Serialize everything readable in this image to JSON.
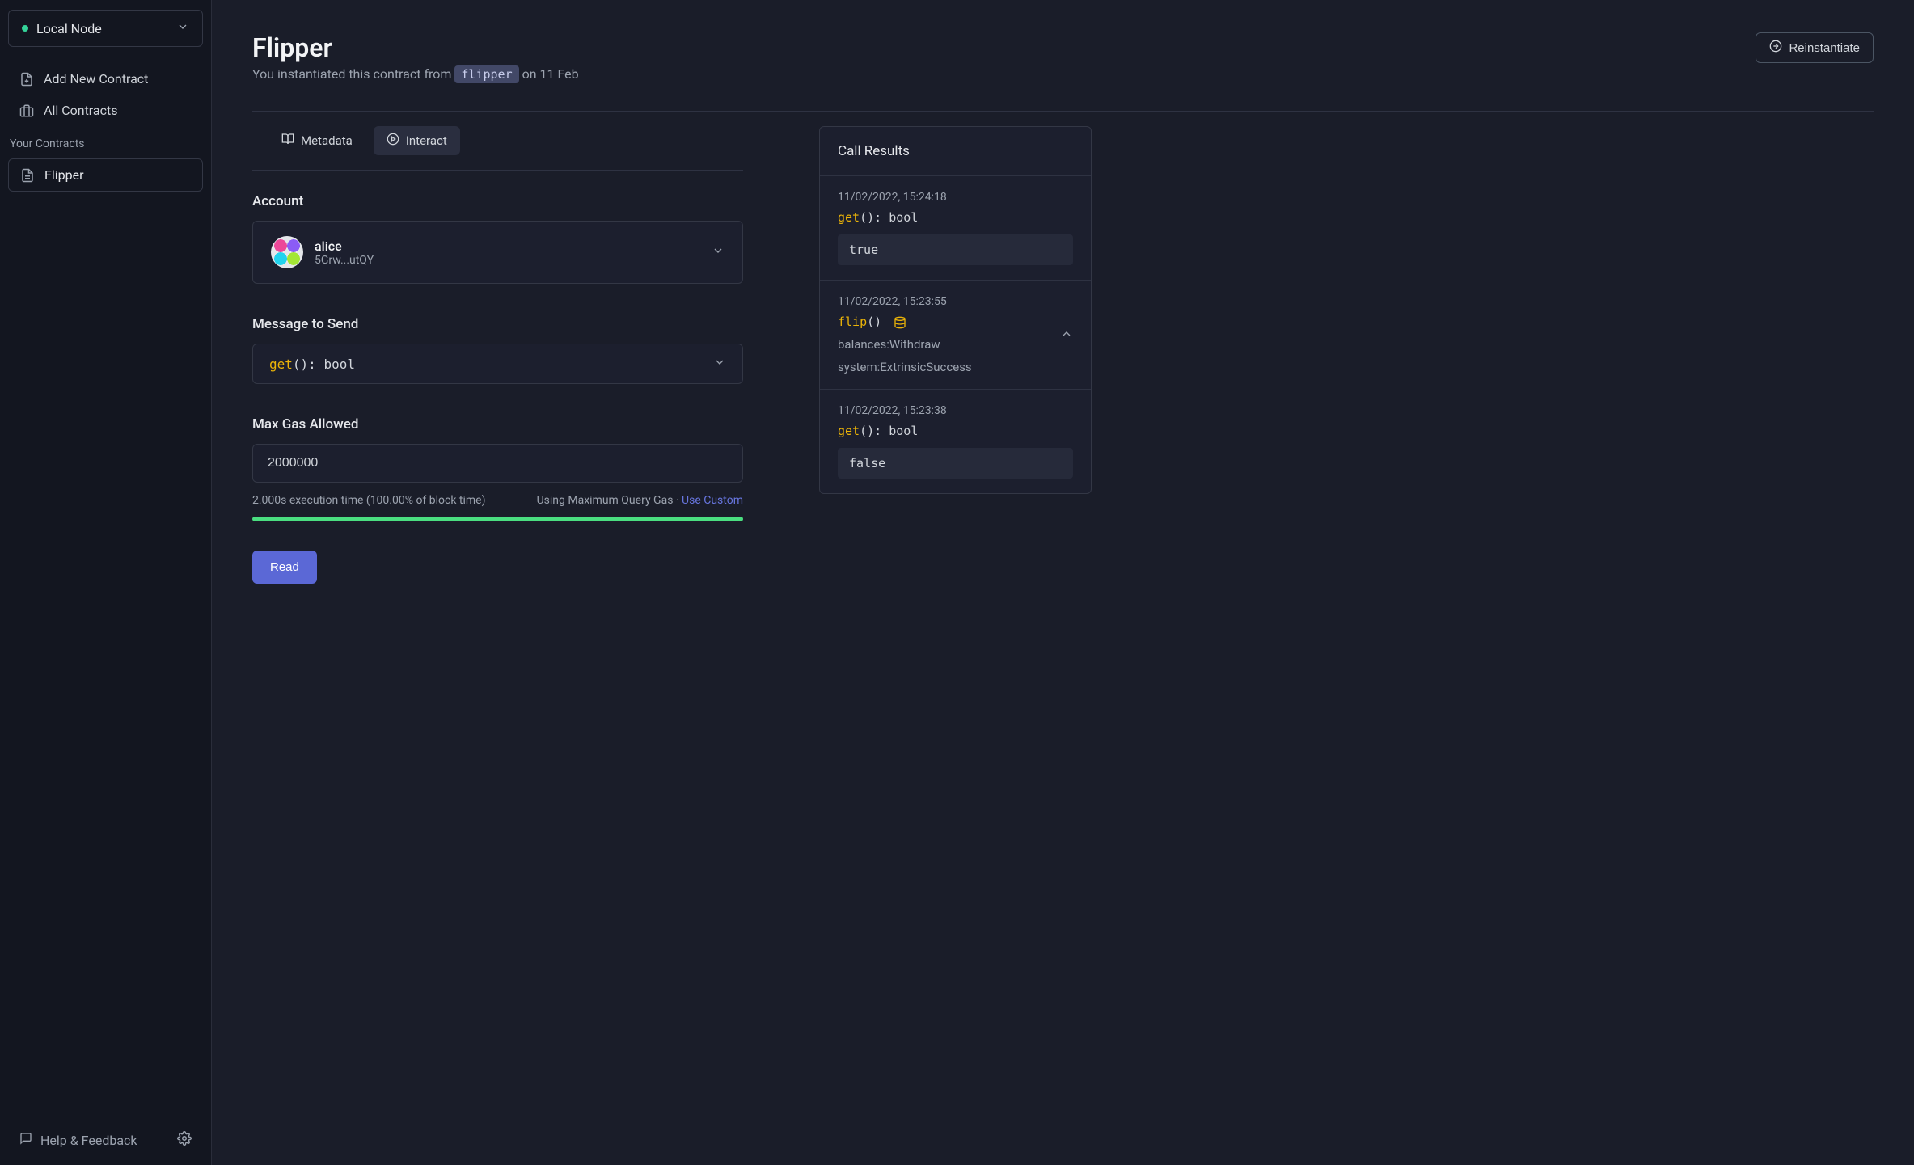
{
  "sidebar": {
    "node_label": "Local Node",
    "add_contract": "Add New Contract",
    "all_contracts": "All Contracts",
    "section_label": "Your Contracts",
    "contracts": [
      {
        "name": "Flipper"
      }
    ],
    "help": "Help & Feedback"
  },
  "header": {
    "title": "Flipper",
    "subtitle_prefix": "You instantiated this contract from ",
    "subtitle_code": "flipper",
    "subtitle_suffix": " on 11 Feb",
    "reinstantiate": "Reinstantiate"
  },
  "tabs": {
    "metadata": "Metadata",
    "interact": "Interact"
  },
  "form": {
    "account_label": "Account",
    "account_name": "alice",
    "account_addr": "5Grw...utQY",
    "message_label": "Message to Send",
    "message_fn": "get",
    "message_sig": "(): bool",
    "gas_label": "Max Gas Allowed",
    "gas_value": "2000000",
    "exec_time": "2.000s execution time (100.00% of block time)",
    "gas_mode": "Using Maximum Query Gas · ",
    "use_custom": "Use Custom",
    "submit": "Read"
  },
  "results": {
    "title": "Call Results",
    "items": [
      {
        "ts": "11/02/2022, 15:24:18",
        "fn": "get",
        "sig": "(): bool",
        "value": "true",
        "type": "query"
      },
      {
        "ts": "11/02/2022, 15:23:55",
        "fn": "flip",
        "sig": "()",
        "type": "tx",
        "events": [
          "balances:Withdraw",
          "system:ExtrinsicSuccess"
        ]
      },
      {
        "ts": "11/02/2022, 15:23:38",
        "fn": "get",
        "sig": "(): bool",
        "value": "false",
        "type": "query"
      }
    ]
  }
}
